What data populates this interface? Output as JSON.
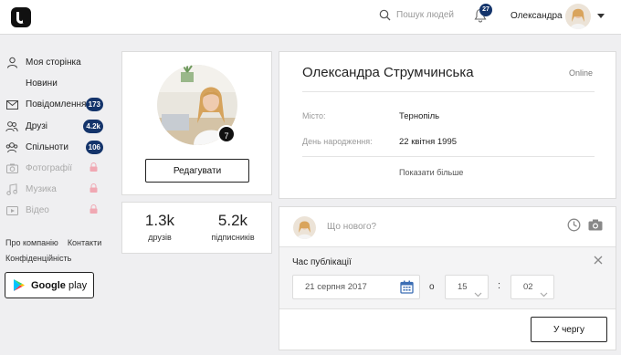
{
  "header": {
    "search_placeholder": "Пошук людей",
    "notifications_count": "27",
    "user_name": "Олександра"
  },
  "sidebar": {
    "items": [
      {
        "label": "Моя сторінка",
        "icon": "user-icon",
        "badge": "",
        "locked": false
      },
      {
        "label": "Новини",
        "icon": "home-icon",
        "badge": "",
        "locked": false
      },
      {
        "label": "Повідомлення",
        "icon": "mail-icon",
        "badge": "173",
        "locked": false
      },
      {
        "label": "Друзі",
        "icon": "friends-icon",
        "badge": "4.2k",
        "locked": false
      },
      {
        "label": "Спільноти",
        "icon": "groups-icon",
        "badge": "106",
        "locked": false
      },
      {
        "label": "Фотографії",
        "icon": "camera-icon",
        "badge": "",
        "locked": true
      },
      {
        "label": "Музика",
        "icon": "music-icon",
        "badge": "",
        "locked": true
      },
      {
        "label": "Відео",
        "icon": "video-icon",
        "badge": "",
        "locked": true
      }
    ],
    "footer_links": [
      "Про компанію",
      "Контакти",
      "Конфіденційність"
    ],
    "store_button": {
      "brand": "Google",
      "word": "play"
    }
  },
  "profile": {
    "avatar_badge": "7",
    "edit_label": "Редагувати",
    "stats": [
      {
        "value": "1.3k",
        "label": "друзів"
      },
      {
        "value": "5.2k",
        "label": "підписників"
      }
    ]
  },
  "info": {
    "full_name": "Олександра Струмчинська",
    "status": "Online",
    "fields": [
      {
        "label": "Місто:",
        "value": "Тернопіль"
      },
      {
        "label": "День народження:",
        "value": "22 квітня 1995"
      }
    ],
    "show_more": "Показати більше"
  },
  "post": {
    "placeholder": "Що нового?",
    "schedule_title": "Час публікації",
    "date_value": "21 серпня 2017",
    "at_label": "о",
    "hour": "15",
    "minute": "02",
    "colon": ":",
    "queue_label": "У чергу"
  },
  "colors": {
    "accent": "#14346b",
    "background": "#efeff1",
    "calendar_icon": "#3c6eb4"
  }
}
